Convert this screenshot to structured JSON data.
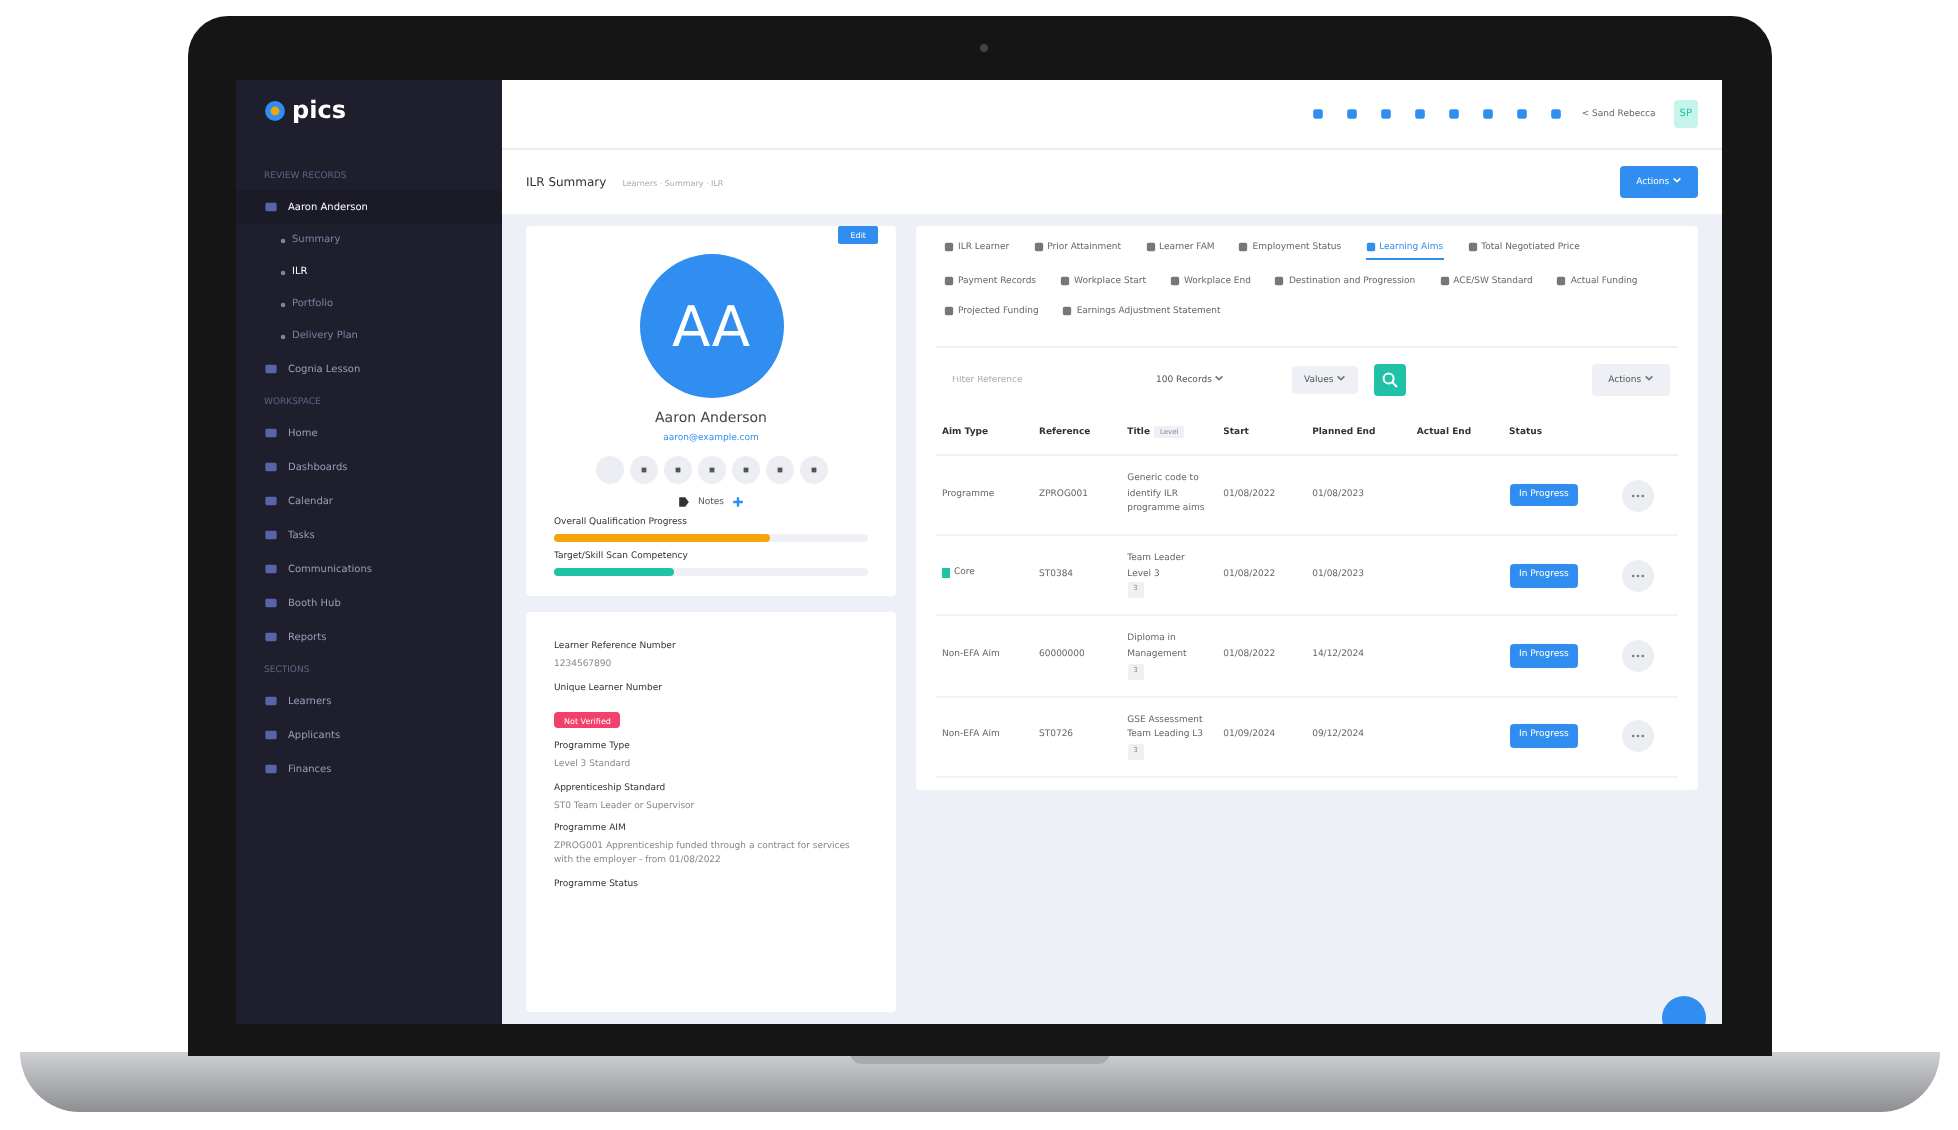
{
  "sidebar": {
    "logo": "pics",
    "sections": [
      {
        "title": "REVIEW RECORDS",
        "items": [
          {
            "label": "Aaron Anderson",
            "selected": false,
            "expanded": true,
            "children": [
              {
                "label": "Summary",
                "selected": false
              },
              {
                "label": "ILR",
                "selected": true
              },
              {
                "label": "Portfolio",
                "selected": false
              },
              {
                "label": "Delivery Plan",
                "selected": false
              }
            ]
          },
          {
            "label": "Cognia Lesson",
            "selected": false,
            "expanded": false
          }
        ]
      },
      {
        "title": "WORKSPACE",
        "items": [
          {
            "label": "Home",
            "selected": false
          },
          {
            "label": "Dashboards",
            "selected": false
          },
          {
            "label": "Calendar",
            "selected": false
          },
          {
            "label": "Tasks",
            "selected": false
          },
          {
            "label": "Communications",
            "selected": false
          },
          {
            "label": "Booth Hub",
            "selected": false
          },
          {
            "label": "Reports",
            "selected": false
          }
        ]
      },
      {
        "title": "SECTIONS",
        "items": [
          {
            "label": "Learners",
            "selected": false
          },
          {
            "label": "Applicants",
            "selected": false
          },
          {
            "label": "Finances",
            "selected": false
          }
        ]
      }
    ]
  },
  "topbar": {
    "workspace": "< Sand Rebecca",
    "avatar": "SP"
  },
  "header": {
    "title": "ILR Summary",
    "breadcrumb": "Learners · Summary · ILR",
    "actions": "Actions"
  },
  "profile": {
    "badge": "Edit",
    "initials": "AA",
    "name": "Aaron Anderson",
    "email": "aaron@example.com",
    "notes": "Notes",
    "progress": [
      {
        "label": "Overall Qualification Progress",
        "level": 0.69,
        "color": "#f5a50a"
      },
      {
        "label": "Target/Skill Scan Competency",
        "level": 0.38,
        "color": "#1fc2a6"
      }
    ]
  },
  "details": [
    {
      "label": "Learner Reference Number",
      "value": "1234567890",
      "kind": "text"
    },
    {
      "label": "Unique Learner Number",
      "value": "Not Verified",
      "kind": "badge"
    },
    {
      "label": "Programme Type",
      "value": "Level 3 Standard",
      "kind": "text"
    },
    {
      "label": "Apprenticeship Standard",
      "value": "ST0 Team Leader or Supervisor",
      "kind": "text"
    },
    {
      "label": "Programme AIM",
      "value": "ZPROG001 Apprenticeship funded through a contract for services with the employer - from 01/08/2022",
      "kind": "text"
    },
    {
      "label": "Programme Status",
      "kind": "cut"
    }
  ],
  "tabs": [
    {
      "label": "ILR Learner",
      "selected": false
    },
    {
      "label": "Prior Attainment",
      "selected": false
    },
    {
      "label": "Learner FAM",
      "selected": false
    },
    {
      "label": "Employment Status",
      "selected": false
    },
    {
      "label": "Learning Aims",
      "selected": true
    },
    {
      "label": "Total Negotiated Price",
      "selected": false
    },
    {
      "label": "Payment Records",
      "selected": false
    },
    {
      "label": "Workplace Start",
      "selected": false
    },
    {
      "label": "Workplace End",
      "selected": false
    },
    {
      "label": "Destination and Progression",
      "selected": false
    },
    {
      "label": "ACE/SW Standard",
      "selected": false
    },
    {
      "label": "Actual Funding",
      "selected": false
    },
    {
      "label": "Projected Funding",
      "selected": false
    },
    {
      "label": "Earnings Adjustment Statement",
      "selected": false
    }
  ],
  "filters": {
    "placeholder": "Filter Reference",
    "records": "100 Records",
    "values": "Values",
    "actions": "Actions"
  },
  "table": {
    "columns": [
      "Aim Type",
      "Reference",
      "Title",
      "Start",
      "Planned End",
      "Actual End",
      "Status"
    ],
    "title_badge": "Level",
    "rows": [
      {
        "aim_type": "Programme",
        "reference": "ZPROG001",
        "title": "Generic code to identify ILR programme aims",
        "start": "01/08/2022",
        "planned_end": "01/08/2023",
        "status": "In Progress",
        "flag": false
      },
      {
        "aim_type": "Core",
        "reference": "ST0384",
        "title": "Team Leader Level 3",
        "level": "3",
        "start": "01/08/2022",
        "planned_end": "01/08/2023",
        "status": "In Progress",
        "flag": true
      },
      {
        "aim_type": "Non-EFA Aim",
        "reference": "60000000",
        "title": "Diploma in Management",
        "level": "3",
        "start": "01/08/2022",
        "planned_end": "14/12/2024",
        "status": "In Progress",
        "flag": false
      },
      {
        "aim_type": "Non-EFA Aim",
        "reference": "ST0726",
        "title": "GSE Assessment Team Leading L3",
        "level": "3",
        "start": "01/09/2024",
        "planned_end": "09/12/2024",
        "status": "In Progress",
        "flag": false
      }
    ]
  }
}
